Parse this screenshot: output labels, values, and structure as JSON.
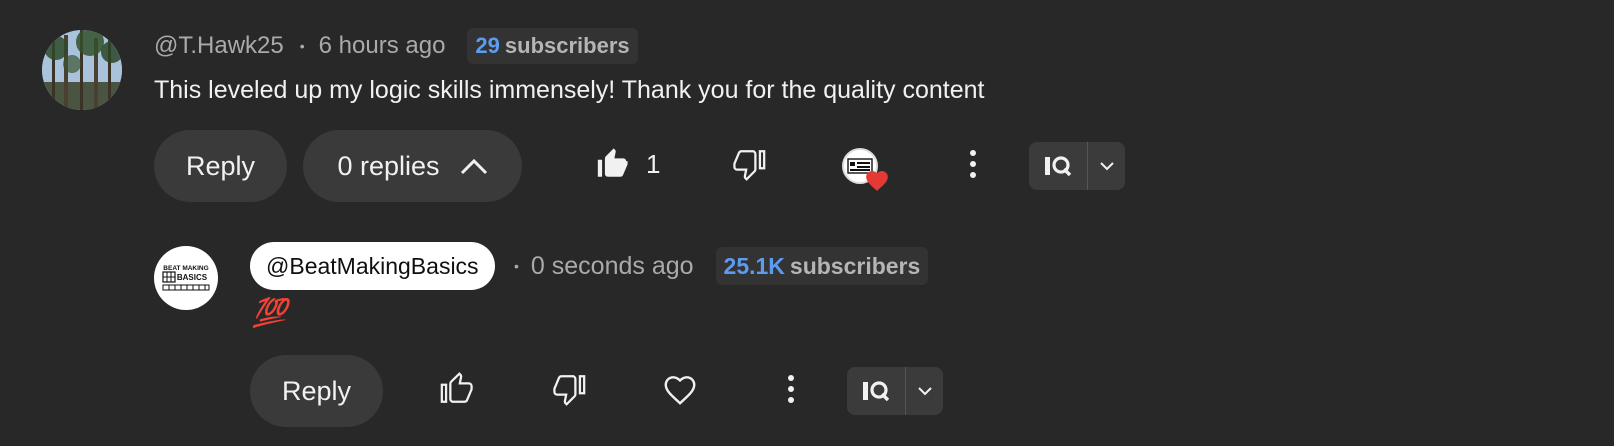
{
  "comment": {
    "author": "@T.Hawk25",
    "separator": "•",
    "time": "6 hours ago",
    "subscribers_count": "29",
    "subscribers_word": "subscribers",
    "text": "This leveled up my logic skills immensely! Thank you for the quality content",
    "reply_label": "Reply",
    "replies_label": "0 replies",
    "like_count": "1",
    "avatar_icon": "tree-photo-avatar",
    "hearted_by_creator": true
  },
  "reply": {
    "author": "@BeatMakingBasics",
    "separator": "•",
    "time": "0 seconds ago",
    "subscribers_count": "25.1K",
    "subscribers_word": "subscribers",
    "text": "💯",
    "reply_label": "Reply",
    "avatar_icon": "beat-making-basics-logo"
  },
  "colors": {
    "background": "#282828",
    "accent_blue": "#5b9cf0",
    "heart_red": "#e53935"
  }
}
